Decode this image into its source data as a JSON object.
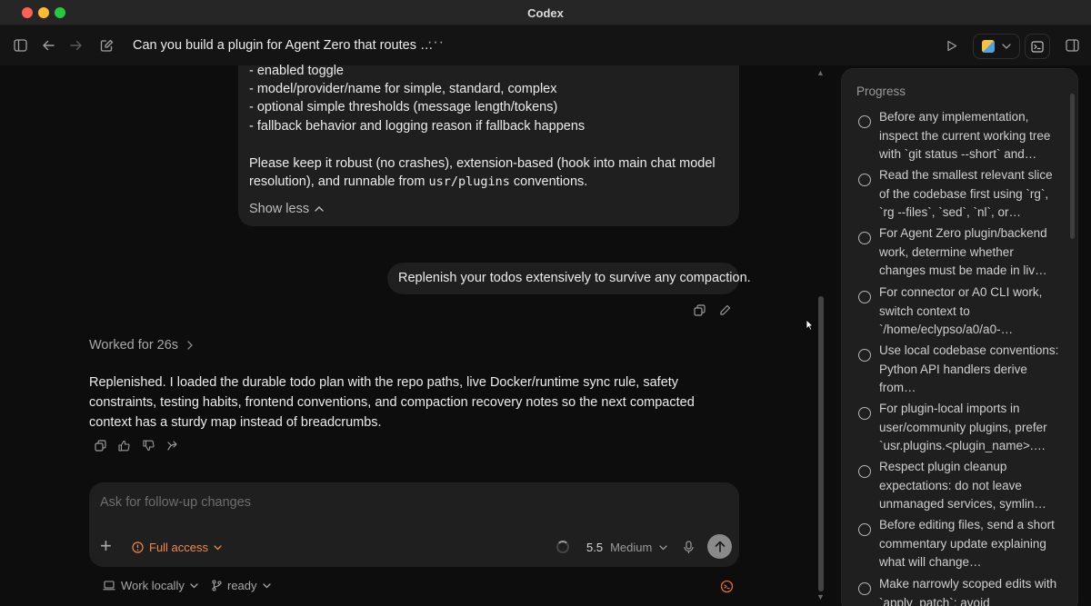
{
  "window": {
    "title": "Codex"
  },
  "toolbar": {
    "thread_title": "Can you build a plugin for Agent Zero that routes …",
    "more_label": "···"
  },
  "user_message": {
    "lines": [
      "- enabled toggle",
      "- model/provider/name for simple, standard, complex",
      "- optional simple thresholds (message length/tokens)",
      "- fallback behavior and logging reason if fallback happens"
    ],
    "para_line1": "Please keep it robust (no crashes), extension-based (hook into main chat model",
    "para_line2_pre": "resolution), and runnable from ",
    "para_line2_code": "usr/plugins",
    "para_line2_post": " conventions.",
    "show_less": "Show less"
  },
  "follow_up": {
    "text": "Replenish your todos extensively to survive any compaction."
  },
  "assistant": {
    "worked": "Worked for 26s",
    "reply": "Replenished. I loaded the durable todo plan with the repo paths, live Docker/runtime sync rule, safety constraints, testing habits, frontend conventions, and compaction recovery notes so the next compacted context has a sturdy map instead of breadcrumbs."
  },
  "composer": {
    "placeholder": "Ask for follow-up changes",
    "access": "Full access",
    "model": "5.5",
    "effort": "Medium"
  },
  "footer": {
    "work_mode": "Work locally",
    "branch": "ready"
  },
  "progress": {
    "title": "Progress",
    "items": [
      {
        "text": "Before any implementation, inspect the current working tree with `git status --short` and…"
      },
      {
        "text": "Read the smallest relevant slice of the codebase first using `rg`, `rg --files`, `sed`, `nl`, or…"
      },
      {
        "text": "For Agent Zero plugin/backend work, determine whether changes must be made in liv…"
      },
      {
        "text": "For connector or A0 CLI work, switch context to `/home/eclypso/a0/a0-…"
      },
      {
        "text": "Use local codebase conventions: Python API handlers derive from…"
      },
      {
        "text": "For plugin-local imports in user/community plugins, prefer `usr.plugins.<plugin_name>.…"
      },
      {
        "text": "Respect plugin cleanup expectations: do not leave unmanaged services, symlin…"
      },
      {
        "text": "Before editing files, send a short commentary update explaining what will change…"
      },
      {
        "text": "Make narrowly scoped edits with `apply_patch`; avoid"
      }
    ]
  },
  "colors": {
    "accent_orange": "#ee8a4d",
    "background": "#0d0d0d",
    "surface": "#1f1f1f"
  },
  "icons": [
    "sidebar-toggle-icon",
    "back-arrow-icon",
    "forward-arrow-icon",
    "new-chat-icon",
    "play-icon",
    "terminal-icon",
    "split-view-icon",
    "copy-icon",
    "edit-icon",
    "thumbs-up-icon",
    "thumbs-down-icon",
    "share-icon",
    "plus-icon",
    "warning-icon",
    "microphone-icon",
    "send-arrow-icon",
    "laptop-icon",
    "branch-icon"
  ]
}
